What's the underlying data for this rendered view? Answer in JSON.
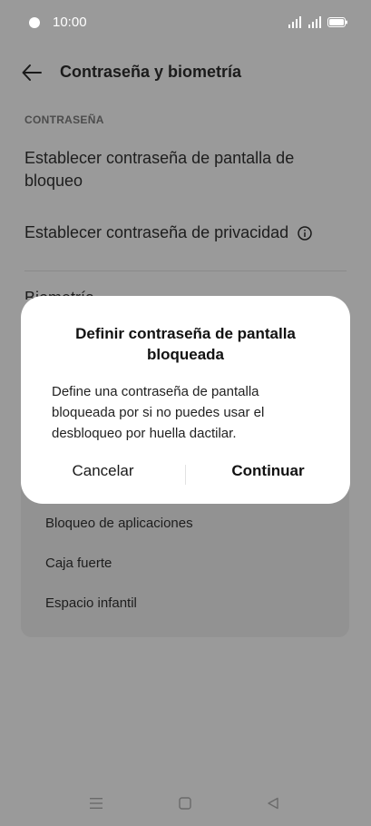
{
  "status_bar": {
    "time": "10:00"
  },
  "header": {
    "title": "Contraseña y biometría",
    "back_icon": "arrow-left-icon"
  },
  "section": {
    "header": "CONTRASEÑA"
  },
  "rows": [
    {
      "label": "Establecer contraseña de pantalla de bloqueo"
    },
    {
      "label": "Establecer contraseña de privacidad",
      "icon": "info-icon"
    }
  ],
  "partial_row": {
    "label": "Biometría"
  },
  "privacy_items": [
    {
      "label": "Bloqueo de aplicaciones"
    },
    {
      "label": "Caja fuerte"
    },
    {
      "label": "Espacio infantil"
    }
  ],
  "dialog": {
    "title": "Definir contraseña de pantalla bloqueada",
    "body": "Define una contraseña de pantalla bloqueada por si no puedes usar el desbloqueo por huella dactilar.",
    "cancel_label": "Cancelar",
    "continue_label": "Continuar"
  },
  "colors": {
    "scrim": "#9a9a9a",
    "dialog_bg": "#ffffff",
    "text": "#1a1a1a"
  }
}
